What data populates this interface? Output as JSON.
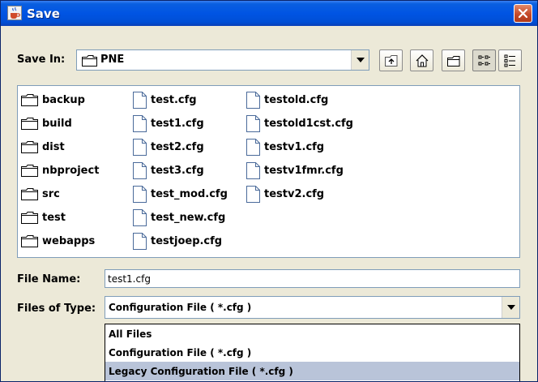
{
  "window": {
    "title": "Save"
  },
  "save_in": {
    "label": "Save In:",
    "value": "PNE"
  },
  "toolbar": {
    "buttons": [
      {
        "name": "up-one-level-icon"
      },
      {
        "name": "home-icon"
      },
      {
        "name": "new-folder-icon"
      },
      {
        "name": "list-view-icon",
        "pressed": true
      },
      {
        "name": "details-view-icon"
      }
    ]
  },
  "files": {
    "columns": [
      [
        {
          "type": "folder",
          "name": "backup"
        },
        {
          "type": "folder",
          "name": "build"
        },
        {
          "type": "folder",
          "name": "dist"
        },
        {
          "type": "folder",
          "name": "nbproject"
        },
        {
          "type": "folder",
          "name": "src"
        },
        {
          "type": "folder",
          "name": "test"
        },
        {
          "type": "folder",
          "name": "webapps"
        }
      ],
      [
        {
          "type": "file",
          "name": "test.cfg"
        },
        {
          "type": "file",
          "name": "test1.cfg"
        },
        {
          "type": "file",
          "name": "test2.cfg"
        },
        {
          "type": "file",
          "name": "test3.cfg"
        },
        {
          "type": "file",
          "name": "test_mod.cfg"
        },
        {
          "type": "file",
          "name": "test_new.cfg"
        },
        {
          "type": "file",
          "name": "testjoep.cfg"
        }
      ],
      [
        {
          "type": "file",
          "name": "testold.cfg"
        },
        {
          "type": "file",
          "name": "testold1cst.cfg"
        },
        {
          "type": "file",
          "name": "testv1.cfg"
        },
        {
          "type": "file",
          "name": "testv1fmr.cfg"
        },
        {
          "type": "file",
          "name": "testv2.cfg"
        }
      ]
    ]
  },
  "file_name": {
    "label": "File Name:",
    "value": "test1.cfg"
  },
  "files_of_type": {
    "label": "Files of Type:",
    "value": "Configuration File ( *.cfg )",
    "options": [
      {
        "label": "All Files",
        "selected": false
      },
      {
        "label": "Configuration File ( *.cfg )",
        "selected": false
      },
      {
        "label": "Legacy Configuration File  ( *.cfg )",
        "selected": true
      }
    ]
  },
  "colors": {
    "accent": "#0054e3",
    "selection": "#b9c4d9",
    "dialog_bg": "#ece9d8"
  }
}
